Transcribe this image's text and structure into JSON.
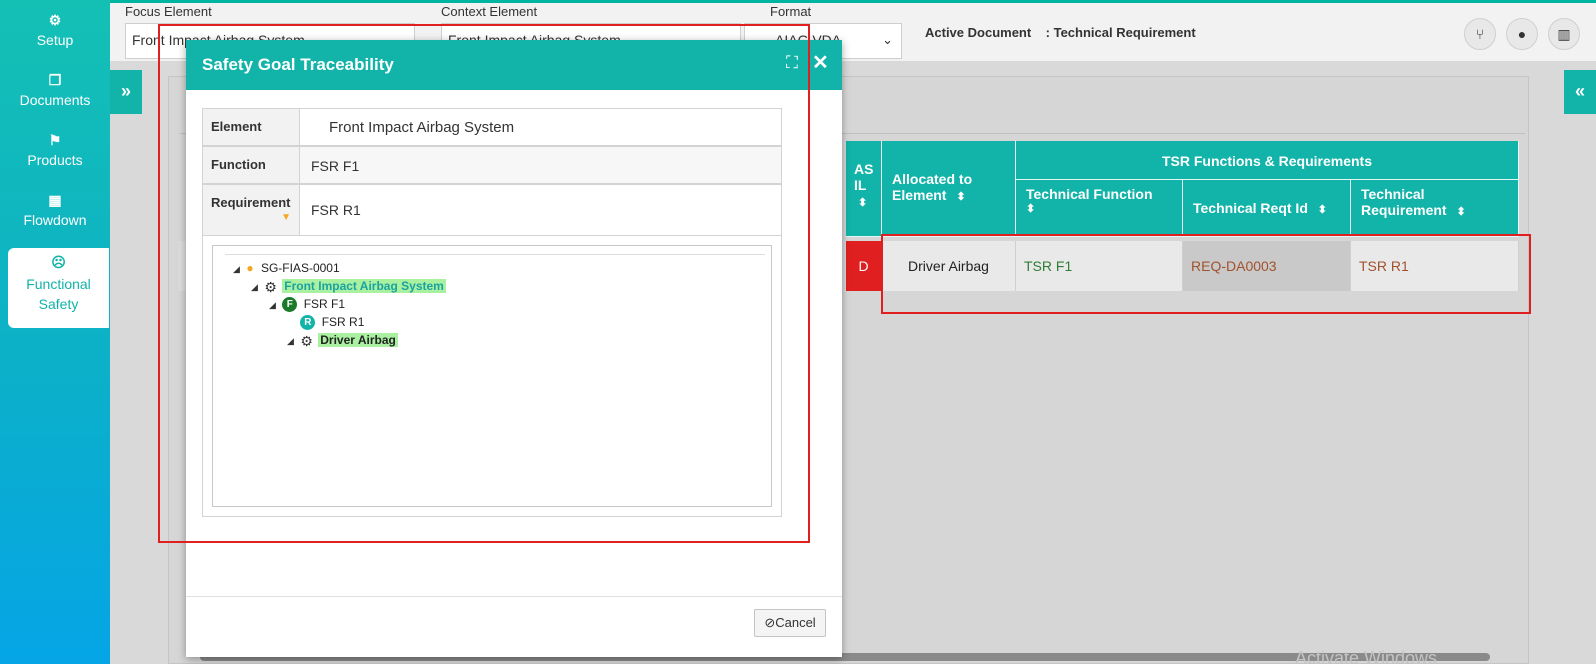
{
  "sidebar": {
    "items": [
      {
        "label": "Setup",
        "icon": "gears-icon"
      },
      {
        "label": "Documents",
        "icon": "copy-icon"
      },
      {
        "label": "Products",
        "icon": "flag-icon"
      },
      {
        "label": "Flowdown",
        "icon": "building-icon"
      },
      {
        "label": "Functional Safety",
        "line1": "Functional",
        "line2": "Safety",
        "icon": "hazard-icon",
        "active": true
      }
    ]
  },
  "header": {
    "focus_label": "Focus Element",
    "focus_value": "Front Impact Airbag System",
    "context_label": "Context Element",
    "context_value": "Front Impact Airbag System",
    "format_label": "Format",
    "format_value": "AIAG VDA",
    "active_doc_label": "Active Document",
    "active_doc_value": ": Technical Requirement"
  },
  "table": {
    "headers": {
      "asil": "AS IL",
      "asil_line1": "AS",
      "asil_line2": "IL",
      "allocated": "Allocated to Element",
      "group": "TSR Functions & Requirements",
      "tech_function": "Technical Function",
      "tech_reqt_id": "Technical Reqt Id",
      "tech_requirement": "Technical Requirement"
    },
    "row": {
      "asil": "D",
      "allocated": "Driver Airbag",
      "tech_function": "TSR F1",
      "tech_reqt_id": "REQ-DA0003",
      "tech_requirement": "TSR R1"
    }
  },
  "modal": {
    "title": "Safety Goal Traceability",
    "element_label": "Element",
    "element_value": "Front Impact Airbag System",
    "function_label": "Function",
    "function_value": "FSR F1",
    "requirement_label": "Requirement",
    "requirement_value": "FSR R1",
    "tree": {
      "root": "SG-FIAS-0001",
      "system": "Front Impact Airbag System",
      "function_badge": "F",
      "function": "FSR F1",
      "requirement_badge": "R",
      "requirement": "FSR R1",
      "element": "Driver Airbag"
    },
    "cancel_label": "Cancel"
  },
  "watermark": "Activate Windows",
  "colors": {
    "accent": "#12b3a8",
    "asil_d": "#e02020",
    "highlight": "#a9f0a0",
    "function_badge": "#1a7a2a",
    "requirement_badge": "#12b3a8"
  }
}
